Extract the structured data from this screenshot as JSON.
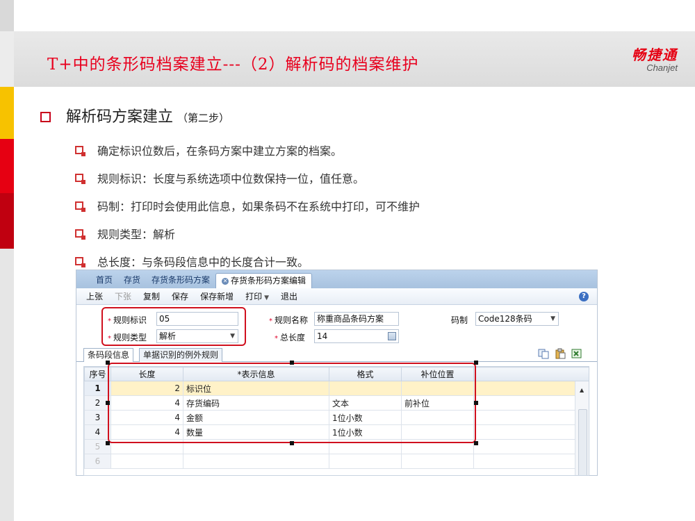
{
  "title": "T+中的条形码档案建立---（2）解析码的档案维护",
  "logo": {
    "cn": "畅捷通",
    "en": "Chanjet"
  },
  "heading": {
    "text": "解析码方案建立",
    "sub": "（第二步）"
  },
  "bullets": [
    "确定标识位数后，在条码方案中建立方案的档案。",
    "规则标识：长度与系统选项中位数保持一位，值任意。",
    "码制：打印时会使用此信息，如果条码不在系统中打印，可不维护",
    "规则类型：解析",
    "总长度：与条码段信息中的长度合计一致。"
  ],
  "app": {
    "tabs": [
      "首页",
      "存货",
      "存货条形码方案",
      "存货条形码方案编辑"
    ],
    "toolbar": [
      "上张",
      "下张",
      "复制",
      "保存",
      "保存新增",
      "打印",
      "退出"
    ],
    "form": {
      "rule_id_label": "规则标识",
      "rule_id_value": "05",
      "rule_name_label": "规则名称",
      "rule_name_value": "称重商品条码方案",
      "code_type_label": "码制",
      "code_type_value": "Code128条码",
      "rule_type_label": "规则类型",
      "rule_type_value": "解析",
      "total_length_label": "总长度",
      "total_length_value": "14"
    },
    "subtabs": [
      "条码段信息",
      "单据识别的例外规则"
    ],
    "grid": {
      "headers": [
        "序号",
        "长度",
        "*表示信息",
        "格式",
        "补位位置"
      ],
      "rows": [
        [
          "1",
          "2",
          "标识位",
          "",
          ""
        ],
        [
          "2",
          "4",
          "存货编码",
          "文本",
          "前补位"
        ],
        [
          "3",
          "4",
          "金额",
          "1位小数",
          ""
        ],
        [
          "4",
          "4",
          "数量",
          "1位小数",
          ""
        ],
        [
          "5",
          "",
          "",
          "",
          ""
        ],
        [
          "6",
          "",
          "",
          "",
          ""
        ]
      ]
    }
  }
}
